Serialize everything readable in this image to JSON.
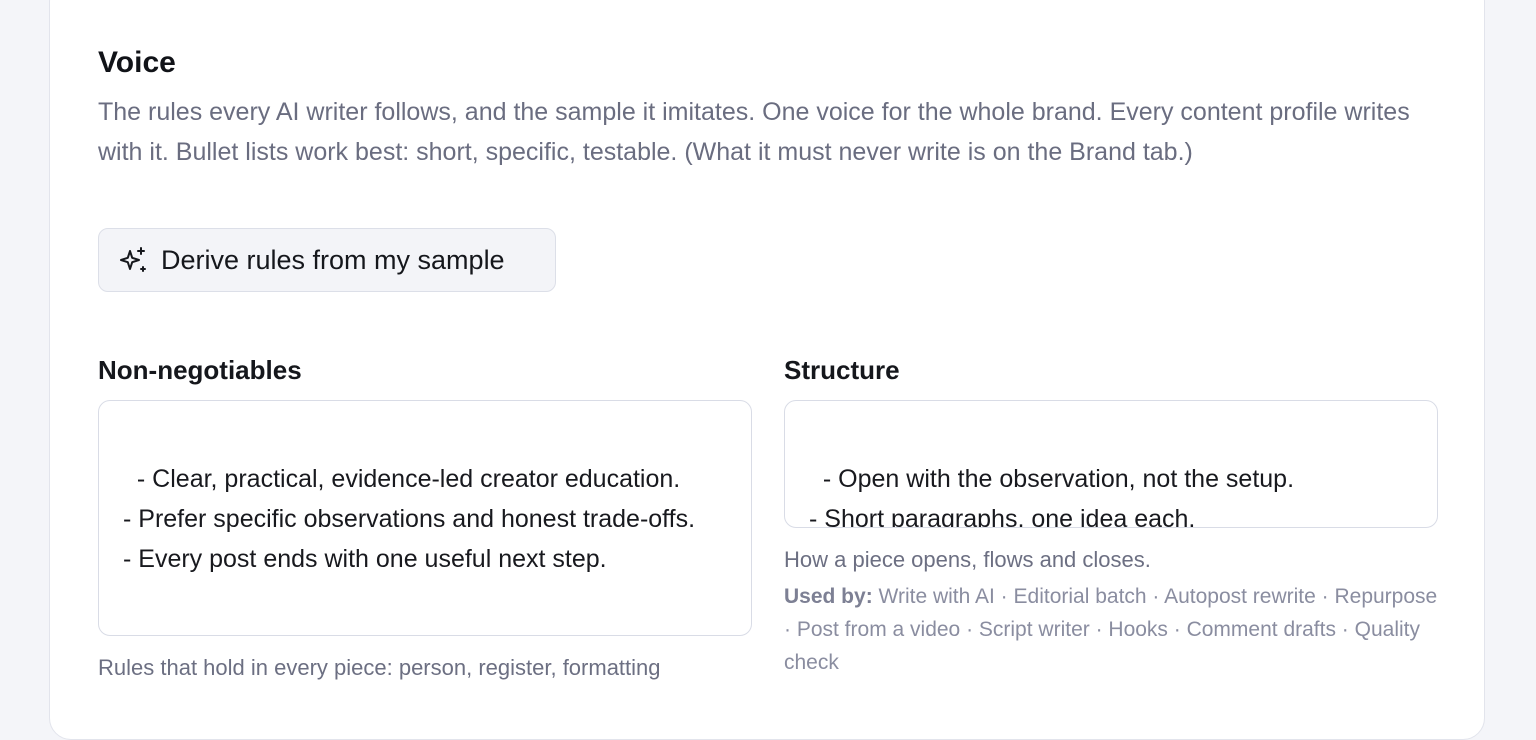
{
  "voice": {
    "title": "Voice",
    "description": "The rules every AI writer follows, and the sample it imitates. One voice for the whole brand. Every content profile writes with it. Bullet lists work best: short, specific, testable. (What it must never write is on the Brand tab.)",
    "derive_button_label": "Derive rules from my sample",
    "derive_button_icon": "sparkles-icon"
  },
  "non_negotiables": {
    "label": "Non-negotiables",
    "value": "- Clear, practical, evidence-led creator education.\n- Prefer specific observations and honest trade-offs.\n- Every post ends with one useful next step.",
    "hint": "Rules that hold in every piece: person, register, formatting"
  },
  "structure": {
    "label": "Structure",
    "value": "- Open with the observation, not the setup.\n- Short paragraphs, one idea each.",
    "hint": "How a piece opens, flows and closes.",
    "used_by_label": "Used by:",
    "used_by_list": "Write with AI · Editorial batch · Autopost rewrite · Repurpose · Post from a video · Script writer · Hooks · Comment drafts · Quality check"
  },
  "colors": {
    "background": "#f4f5f9",
    "card": "#ffffff",
    "muted_text": "#6a6d80",
    "border": "#d9dce6"
  }
}
